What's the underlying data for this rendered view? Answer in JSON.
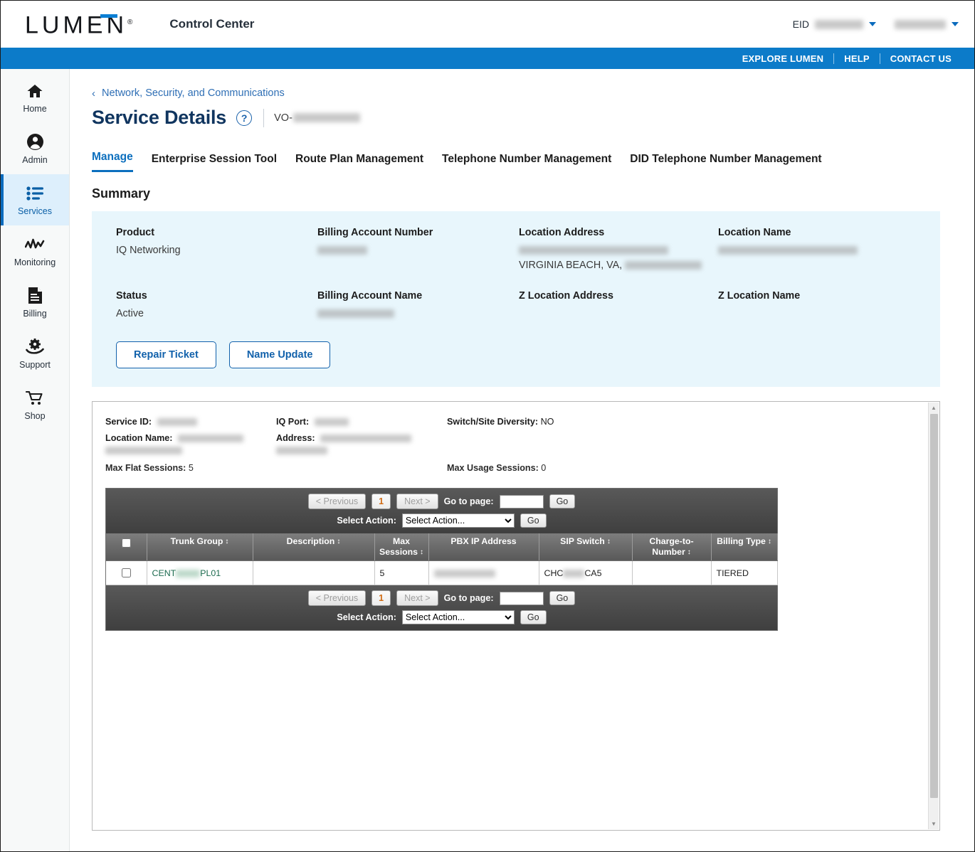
{
  "header": {
    "logo": "LUMEN",
    "logo_reg": "®",
    "app_title": "Control Center",
    "eid_label": "EID",
    "eid_value": "",
    "user_value": "",
    "nav": [
      {
        "label": "EXPLORE LUMEN"
      },
      {
        "label": "HELP"
      },
      {
        "label": "CONTACT US"
      }
    ]
  },
  "sidebar": {
    "items": [
      {
        "label": "Home",
        "icon": "home-icon",
        "active": false
      },
      {
        "label": "Admin",
        "icon": "person-circle-icon",
        "active": false
      },
      {
        "label": "Services",
        "icon": "list-icon",
        "active": true
      },
      {
        "label": "Monitoring",
        "icon": "activity-icon",
        "active": false
      },
      {
        "label": "Billing",
        "icon": "invoice-icon",
        "active": false
      },
      {
        "label": "Support",
        "icon": "gear-hand-icon",
        "active": false
      },
      {
        "label": "Shop",
        "icon": "cart-icon",
        "active": false
      }
    ]
  },
  "breadcrumb": {
    "label": "Network, Security, and Communications"
  },
  "page_title": {
    "title": "Service Details",
    "help_glyph": "?",
    "id_prefix": "VO-",
    "id_value": ""
  },
  "tabs": [
    {
      "label": "Manage",
      "selected": true
    },
    {
      "label": "Enterprise Session Tool",
      "selected": false
    },
    {
      "label": "Route Plan Management",
      "selected": false
    },
    {
      "label": "Telephone Number Management",
      "selected": false
    },
    {
      "label": "DID Telephone Number Management",
      "selected": false
    }
  ],
  "summary": {
    "section_title": "Summary",
    "fields": [
      {
        "label": "Product",
        "value": "IQ Networking",
        "masked": false
      },
      {
        "label": "Billing Account Number",
        "value": "",
        "masked": true
      },
      {
        "label": "Location Address",
        "value": "",
        "value2": "VIRGINIA BEACH, VA,",
        "masked": true
      },
      {
        "label": "Location Name",
        "value": "",
        "masked": true
      },
      {
        "label": "Status",
        "value": "Active",
        "masked": false
      },
      {
        "label": "Billing Account Name",
        "value": "",
        "masked": true
      },
      {
        "label": "Z Location Address",
        "value": "",
        "masked": false
      },
      {
        "label": "Z Location Name",
        "value": "",
        "masked": false
      }
    ],
    "buttons": [
      {
        "label": "Repair Ticket"
      },
      {
        "label": "Name Update"
      }
    ]
  },
  "details": {
    "service_id_label": "Service ID:",
    "service_id_value": "",
    "iq_port_label": "IQ Port:",
    "iq_port_value": "",
    "switch_diversity_label": "Switch/Site Diversity:",
    "switch_diversity_value": "NO",
    "location_name_label": "Location Name:",
    "location_name_value": "",
    "address_label": "Address:",
    "address_value": "",
    "max_flat_label": "Max Flat Sessions:",
    "max_flat_value": "5",
    "max_usage_label": "Max Usage Sessions:",
    "max_usage_value": "0"
  },
  "pager": {
    "previous": "< Previous",
    "page_number": "1",
    "next": "Next >",
    "goto_label": "Go to page:",
    "goto_value": "",
    "go": "Go",
    "select_action_label": "Select Action:",
    "select_action_value": "Select Action...",
    "select_action_go": "Go"
  },
  "table": {
    "columns": [
      {
        "label": "",
        "sortable": false,
        "key": "checkbox"
      },
      {
        "label": "Trunk Group",
        "sortable": true
      },
      {
        "label": "Description",
        "sortable": true
      },
      {
        "label": "Max Sessions",
        "sortable": true
      },
      {
        "label": "PBX IP Address",
        "sortable": false
      },
      {
        "label": "SIP Switch",
        "sortable": true
      },
      {
        "label": "Charge-to-Number",
        "sortable": true
      },
      {
        "label": "Billing Type",
        "sortable": true
      }
    ],
    "rows": [
      {
        "trunk_group_prefix": "CENT",
        "trunk_group_suffix": "PL01",
        "description": "",
        "max_sessions": "5",
        "pbx_ip_address": "",
        "sip_switch_prefix": "CHC",
        "sip_switch_suffix": "CA5",
        "charge_to_number": "",
        "billing_type": "TIERED"
      }
    ]
  },
  "colors": {
    "brand_blue": "#0c7bc9",
    "accent_blue": "#0c6fbe",
    "summary_bg": "#e8f6fc",
    "title_navy": "#10355f",
    "link_green": "#1d6b4f",
    "page_orange": "#d06a12"
  }
}
